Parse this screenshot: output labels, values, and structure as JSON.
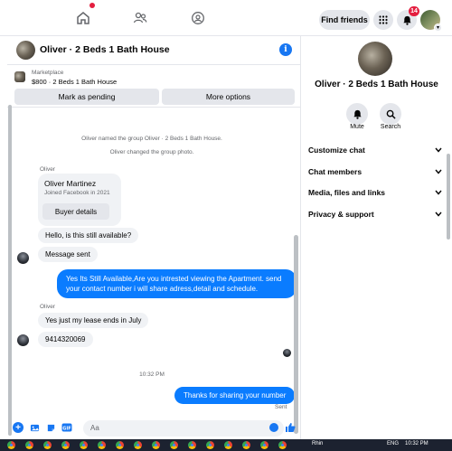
{
  "topnav": {
    "find_friends": "Find friends",
    "notif_count": "14"
  },
  "chat": {
    "title": "Oliver · 2 Beds 1 Bath House",
    "marketplace_label": "Marketplace",
    "listing": "$800 · 2 Beds 1 Bath House",
    "mark_pending": "Mark as pending",
    "more_options": "More options",
    "system_msgs": [
      "Oliver named the group Oliver · 2 Beds 1 Bath House.",
      "Oliver changed the group photo."
    ],
    "sender_name": "Oliver",
    "card_name": "Oliver Martinez",
    "card_sub": "Joined Facebook in 2021",
    "card_button": "Buyer details",
    "messages_in": [
      "Hello, is this still available?",
      "Message sent"
    ],
    "message_out_1": "Yes Its Still Available,Are you intrested viewing the Apartment. send your contact number i will share adress,detail and schedule.",
    "sender_name_2": "Oliver",
    "messages_in_2": [
      "Yes just my lease ends in July",
      "9414320069"
    ],
    "time": "10:32 PM",
    "message_out_2": "Thanks for sharing your number",
    "sent_label": "Sent",
    "composer_placeholder": "Aa"
  },
  "right": {
    "title": "Oliver · 2 Beds 1 Bath House",
    "mute": "Mute",
    "search": "Search",
    "rows": [
      "Customize chat",
      "Chat members",
      "Media, files and links",
      "Privacy & support"
    ]
  },
  "taskbar": {
    "app_label": "Rhin",
    "lang": "ENG",
    "clock": "10:32 PM"
  },
  "colors": {
    "accent": "#1877f2",
    "bubble_out": "#0a7cff",
    "bubble_in": "#f0f2f5",
    "badge": "#e41e3f"
  }
}
